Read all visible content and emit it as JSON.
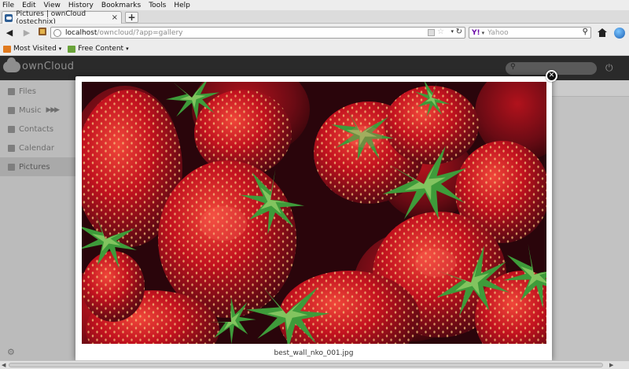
{
  "browser": {
    "menu": [
      "File",
      "Edit",
      "View",
      "History",
      "Bookmarks",
      "Tools",
      "Help"
    ],
    "tab": {
      "title": "Pictures | ownCloud (ostechnix)",
      "close": "×"
    },
    "new_tab": "+",
    "nav": {
      "back": "◀",
      "forward": "▶",
      "reload": "↻",
      "dropdown": "▾"
    },
    "url": {
      "host": "localhost",
      "path": "/owncloud/?app=gallery"
    },
    "search": {
      "engine_glyph": "Y!",
      "placeholder": "Yahoo",
      "icon": "search-icon"
    },
    "bookmarks": [
      {
        "label": "Most Visited",
        "color": "#e07a1f"
      },
      {
        "label": "Free Content",
        "color": "#6aa33a"
      }
    ]
  },
  "owncloud": {
    "logo_text": "ownCloud",
    "logout_glyph": "⏻",
    "nav": [
      {
        "label": "Files",
        "active": false
      },
      {
        "label": "Music",
        "active": false,
        "controls": "▶ ▶▶"
      },
      {
        "label": "Contacts",
        "active": false
      },
      {
        "label": "Calendar",
        "active": false
      },
      {
        "label": "Pictures",
        "active": true
      }
    ],
    "settings_glyph": "⚙"
  },
  "lightbox": {
    "caption": "best_wall_nko_001.jpg",
    "close_glyph": "✕",
    "image_subject": "strawberries"
  },
  "colors": {
    "header_bg": "#2a2a2a",
    "sidebar_bg": "#d2d2d2",
    "strawberry_red": "#c1121f",
    "leaf_green": "#3e9b3a"
  }
}
